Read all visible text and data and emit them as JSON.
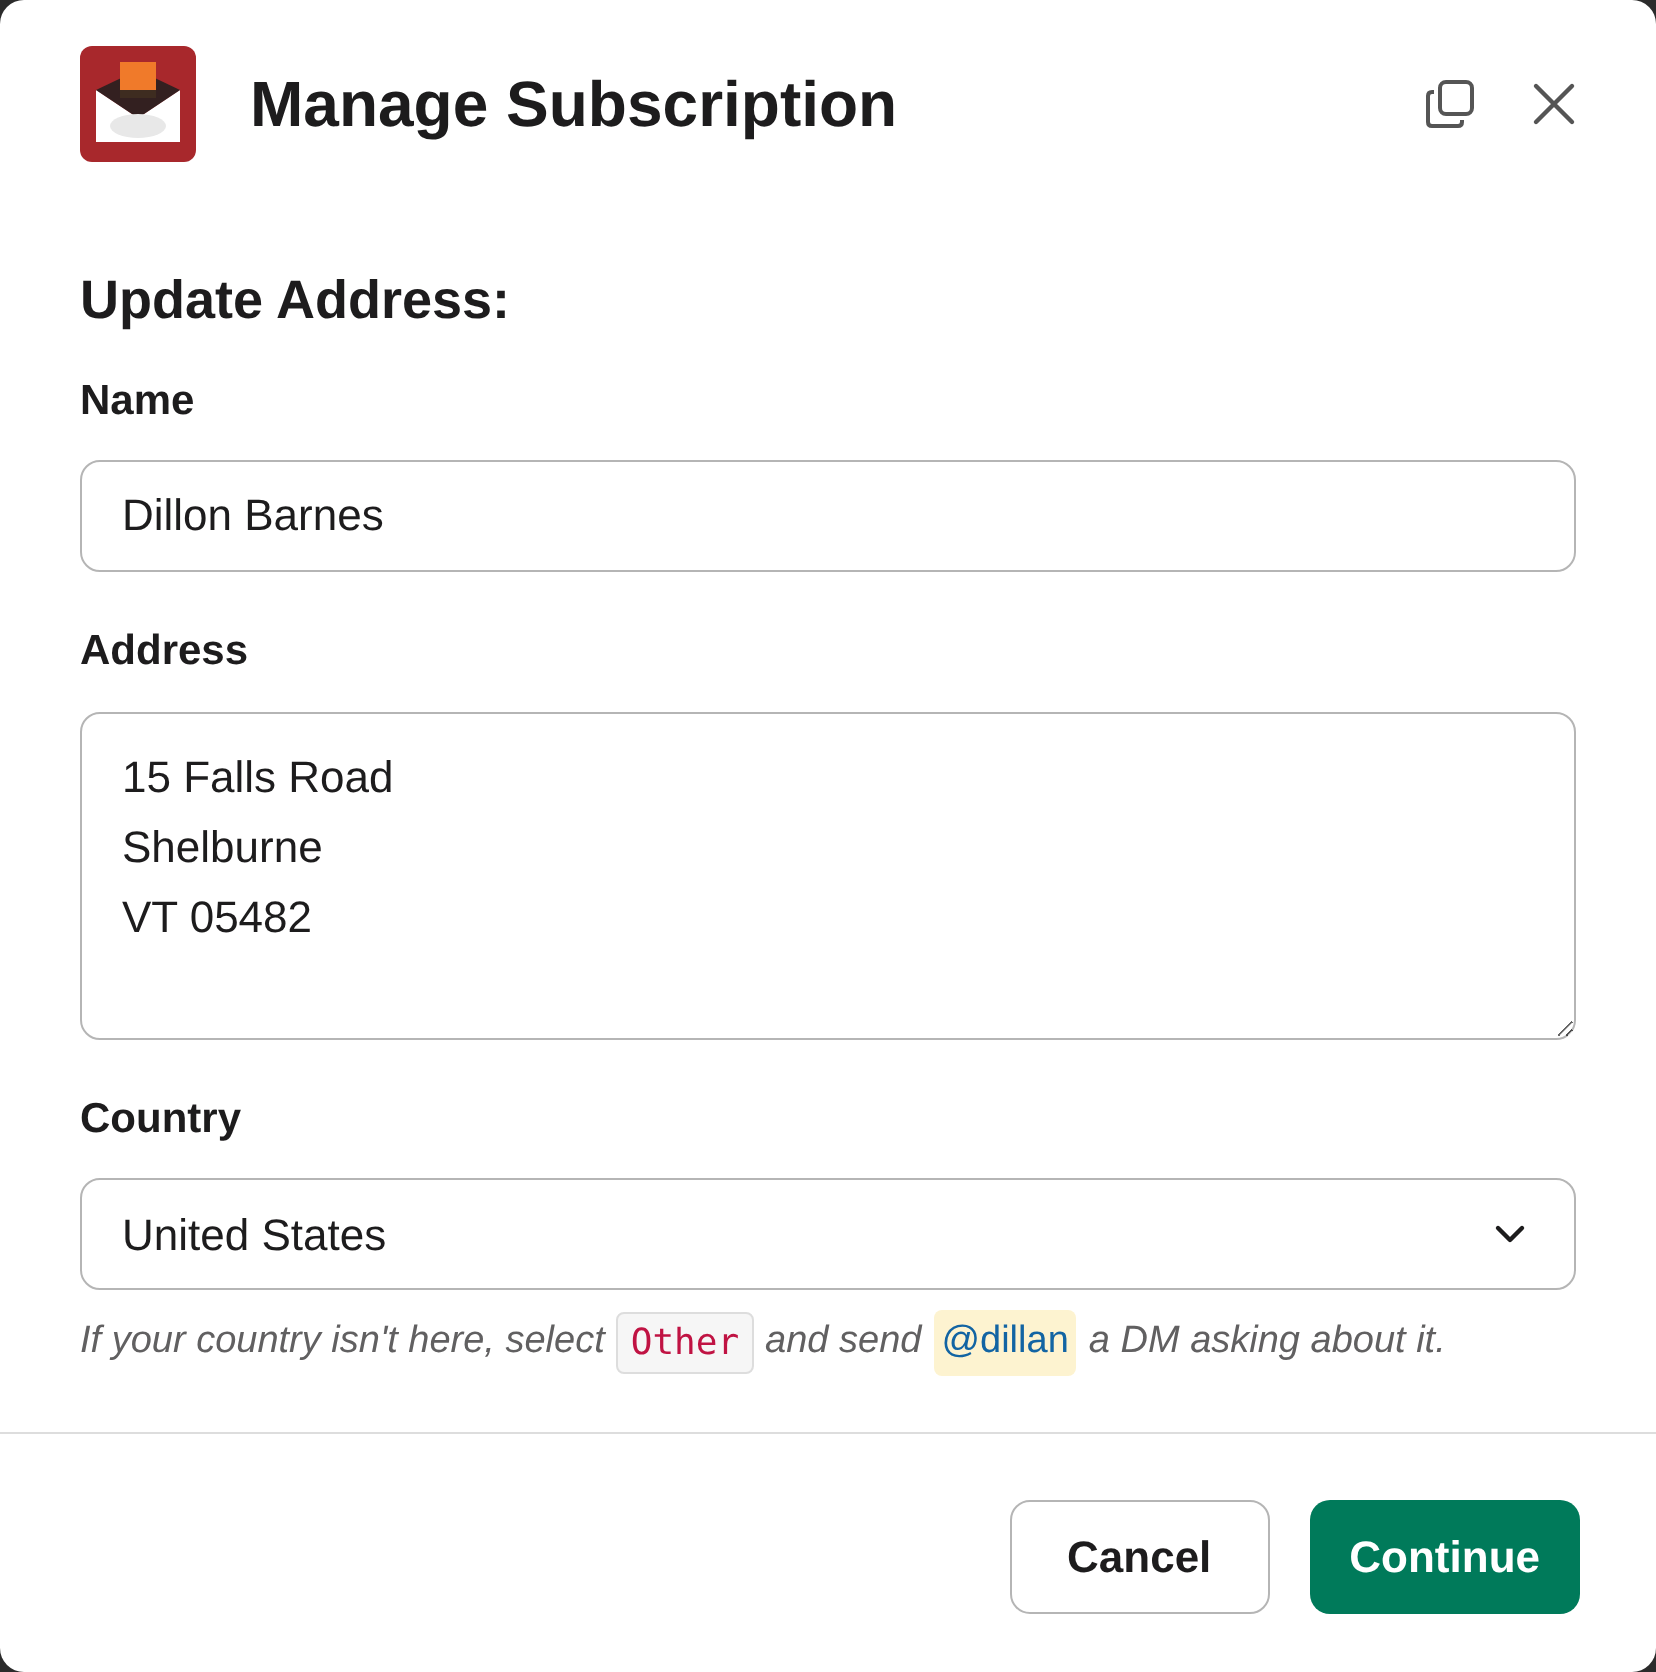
{
  "modal": {
    "title": "Manage Subscription"
  },
  "section_title": "Update Address:",
  "fields": [
    {
      "kind": "text",
      "label": "Name",
      "value": "Dillon Barnes"
    },
    {
      "kind": "textarea",
      "label": "Address",
      "value": "15 Falls Road\nShelburne\nVT 05482"
    },
    {
      "kind": "select",
      "label": "Country",
      "value": "United States"
    }
  ],
  "hint": [
    {
      "kind": "text",
      "text": "If your country isn't here, select"
    },
    {
      "kind": "code",
      "text": "Other"
    },
    {
      "kind": "text",
      "text": "and send"
    },
    {
      "kind": "mention",
      "text": "@dillan"
    },
    {
      "kind": "text",
      "text": "a DM asking about it."
    }
  ],
  "buttons": [
    {
      "kind": "secondary",
      "label": "Cancel"
    },
    {
      "kind": "primary",
      "label": "Continue"
    }
  ]
}
